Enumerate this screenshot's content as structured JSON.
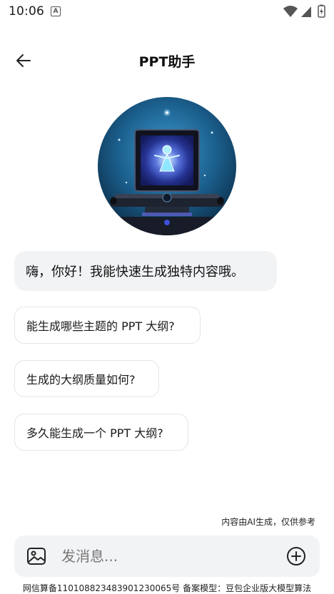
{
  "status_bar": {
    "time": "10:06",
    "notification_glyph": "A",
    "icons": [
      "wifi-icon",
      "signal-icon",
      "battery-charging-icon"
    ]
  },
  "header": {
    "title": "PPT助手",
    "back_icon": "arrow-left-icon"
  },
  "avatar": {
    "icon": "ai-assistant-avatar"
  },
  "chat": {
    "greeting": "嗨，你好！我能快速生成独特内容哦。",
    "suggestions": [
      "能生成哪些主题的 PPT 大纲?",
      "生成的大纲质量如何?",
      "多久能生成一个 PPT 大纲?"
    ]
  },
  "ai_note": "内容由AI生成，仅供参考",
  "input_bar": {
    "placeholder": "发消息...",
    "image_icon": "image-icon",
    "add_icon": "plus-circle-icon"
  },
  "footer_note": "网信算备110108823483901230065号 备案模型：豆包企业版大模型算法",
  "colors": {
    "bubble_bg": "#f2f3f5",
    "suggestion_border": "#e4e5e8",
    "text": "#111111"
  }
}
